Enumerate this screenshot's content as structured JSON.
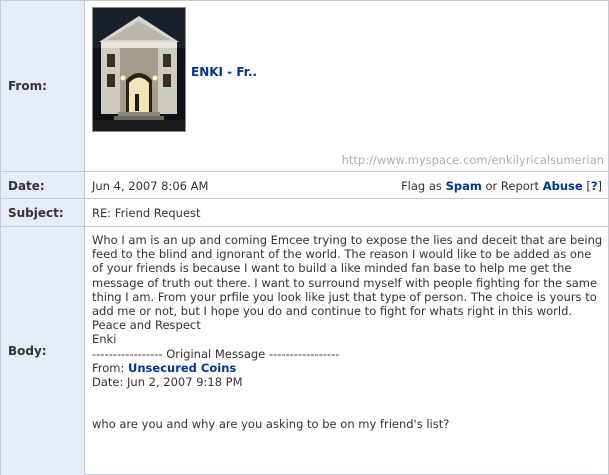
{
  "from": {
    "label": "From:",
    "name": "ENKI - Fr..",
    "url": "http://www.myspace.com/enkilyricalsumerian"
  },
  "date": {
    "label": "Date:",
    "value": "Jun 4, 2007 8:06 AM",
    "flag_prefix": "Flag as",
    "spam_label": "Spam",
    "report_text": "or Report",
    "abuse_label": "Abuse",
    "bracket_open": "[",
    "help_label": "?",
    "bracket_close": "]"
  },
  "subject": {
    "label": "Subject:",
    "value": "RE: Friend Request"
  },
  "body": {
    "label": "Body:",
    "paragraph": "Who I am is an up and coming Emcee trying to expose the lies and deceit that are being feed to the blind and ignorant of the world. The reason I would like to be added as one of your friends is because I want to build a like minded fan base to help me get the message of truth out there. I want to surround myself with people fighting for the same thing I am. From your prfile you look like just that type of person. The choice is yours to add me or not, but I hope you do and continue to fight for whats right in this world.",
    "closing": "Peace and Respect",
    "signature": "Enki",
    "original_header": "----------------- Original Message -----------------",
    "orig_from_label": "From:",
    "orig_from_name": "Unsecured Coins",
    "orig_date": "Date: Jun 2, 2007 9:18 PM",
    "orig_text": "who are you and why are you asking to be on my friend's list?"
  },
  "colors": {
    "label_bg": "#e4ecf7",
    "link": "#003399",
    "border": "#c6cbd3"
  }
}
